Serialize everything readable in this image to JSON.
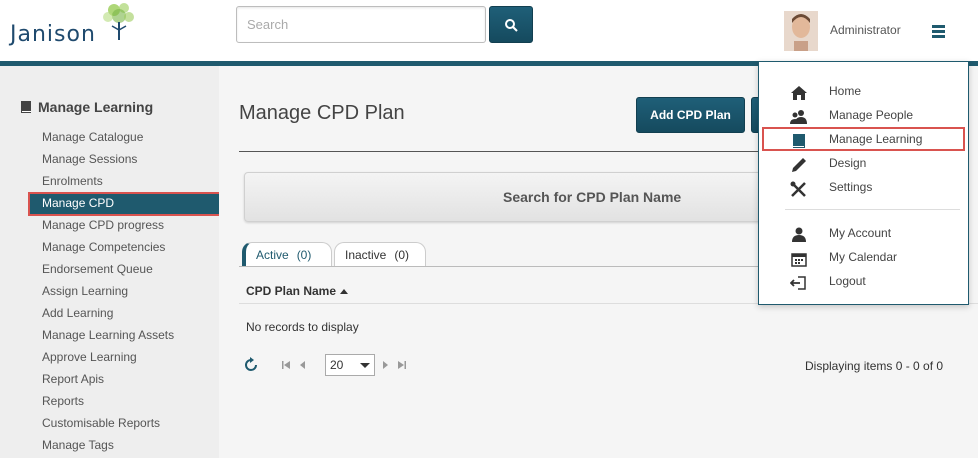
{
  "header": {
    "logo_text": "Janison",
    "search_placeholder": "Search",
    "user_name": "Administrator"
  },
  "sidebar": {
    "title": "Manage Learning",
    "items": [
      "Manage Catalogue",
      "Manage Sessions",
      "Enrolments",
      "Manage CPD",
      "Manage CPD progress",
      "Manage Competencies",
      "Endorsement Queue",
      "Assign Learning",
      "Add Learning",
      "Manage Learning Assets",
      "Approve Learning",
      "Report Apis",
      "Reports",
      "Customisable Reports",
      "Manage Tags"
    ],
    "active_index": 3
  },
  "main": {
    "title": "Manage CPD Plan",
    "add_button": "Add CPD Plan",
    "search_panel": "Search for CPD Plan Name",
    "tabs": [
      {
        "label": "Active",
        "count": "(0)"
      },
      {
        "label": "Inactive",
        "count": "(0)"
      }
    ],
    "column_header": "CPD Plan Name",
    "empty_text": "No records to display",
    "page_size": "20",
    "displaying": "Displaying items 0 - 0 of 0"
  },
  "dropdown": {
    "items": [
      {
        "label": "Home",
        "icon": "home-icon"
      },
      {
        "label": "Manage People",
        "icon": "people-icon"
      },
      {
        "label": "Manage Learning",
        "icon": "book-icon"
      },
      {
        "label": "Design",
        "icon": "pencil-icon"
      },
      {
        "label": "Settings",
        "icon": "tools-icon"
      },
      {
        "label": "My Account",
        "icon": "user-icon"
      },
      {
        "label": "My Calendar",
        "icon": "calendar-icon"
      },
      {
        "label": "Logout",
        "icon": "logout-icon"
      }
    ],
    "highlighted_index": 2
  },
  "colors": {
    "accent": "#1f5a6e",
    "highlight_border": "#d9534f"
  }
}
